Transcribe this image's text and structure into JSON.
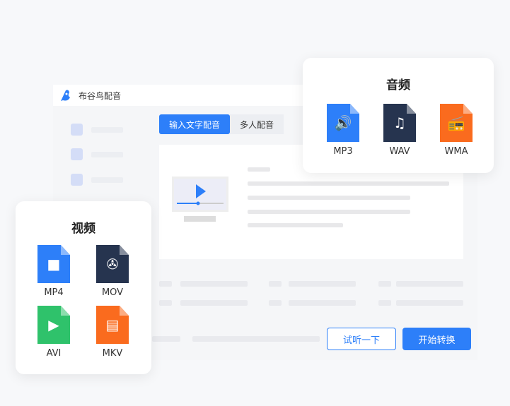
{
  "app": {
    "title": "布谷鸟配音"
  },
  "tabs": [
    {
      "label": "输入文字配音"
    },
    {
      "label": "多人配音"
    }
  ],
  "buttons": {
    "preview": "试听一下",
    "convert": "开始转换"
  },
  "audio_card": {
    "title": "音频",
    "files": [
      {
        "label": "MP3",
        "color": "#2d7ff9",
        "icon": "speaker-icon"
      },
      {
        "label": "WAV",
        "color": "#26344f",
        "icon": "music-note-icon"
      },
      {
        "label": "WMA",
        "color": "#fa6b1e",
        "icon": "radio-icon"
      }
    ]
  },
  "video_card": {
    "title": "视频",
    "files": [
      {
        "label": "MP4",
        "color": "#2d7ff9",
        "icon": "camera-icon"
      },
      {
        "label": "MOV",
        "color": "#26344f",
        "icon": "film-reel-icon"
      },
      {
        "label": "AVI",
        "color": "#2fc26b",
        "icon": "play-icon"
      },
      {
        "label": "MKV",
        "color": "#fa6b1e",
        "icon": "film-strip-icon"
      }
    ]
  }
}
